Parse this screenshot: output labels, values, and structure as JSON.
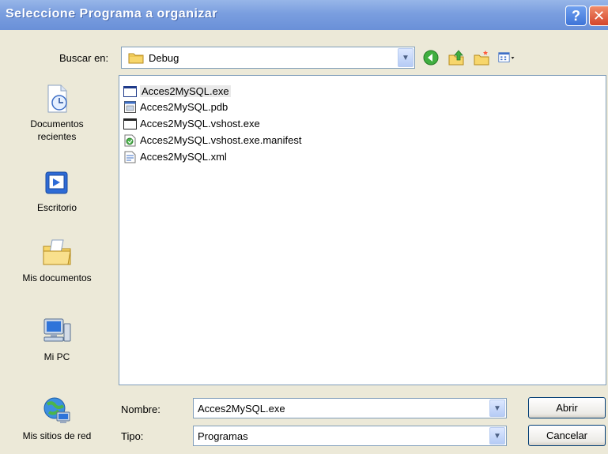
{
  "window": {
    "title": "Seleccione Programa a organizar",
    "help_glyph": "?",
    "close_glyph": "✕"
  },
  "lookin": {
    "label": "Buscar en:",
    "value": "Debug"
  },
  "toolbar": {
    "icons": [
      "back-icon",
      "up-folder-icon",
      "new-folder-icon",
      "view-menu-icon"
    ]
  },
  "places": {
    "items": [
      {
        "label": "Documentos recientes",
        "icon": "recent-documents-icon"
      },
      {
        "label": "Escritorio",
        "icon": "desktop-icon"
      },
      {
        "label": "Mis documentos",
        "icon": "my-documents-icon"
      },
      {
        "label": "Mi PC",
        "icon": "my-computer-icon"
      },
      {
        "label": "Mis sitios de red",
        "icon": "network-places-icon"
      }
    ]
  },
  "files": [
    {
      "name": "Acces2MySQL.exe",
      "icon": "exe-icon",
      "selected": true
    },
    {
      "name": "Acces2MySQL.pdb",
      "icon": "pdb-icon",
      "selected": false
    },
    {
      "name": "Acces2MySQL.vshost.exe",
      "icon": "exe-icon",
      "selected": false
    },
    {
      "name": "Acces2MySQL.vshost.exe.manifest",
      "icon": "manifest-icon",
      "selected": false
    },
    {
      "name": "Acces2MySQL.xml",
      "icon": "xml-icon",
      "selected": false
    }
  ],
  "filename": {
    "label": "Nombre:",
    "value": "Acces2MySQL.exe"
  },
  "filetype": {
    "label": "Tipo:",
    "value": "Programas"
  },
  "buttons": {
    "open": "Abrir",
    "cancel": "Cancelar"
  },
  "colors": {
    "titlebar": "#7A9EDF",
    "dialog_bg": "#ECE9D8",
    "field_border": "#7F9DB9"
  }
}
